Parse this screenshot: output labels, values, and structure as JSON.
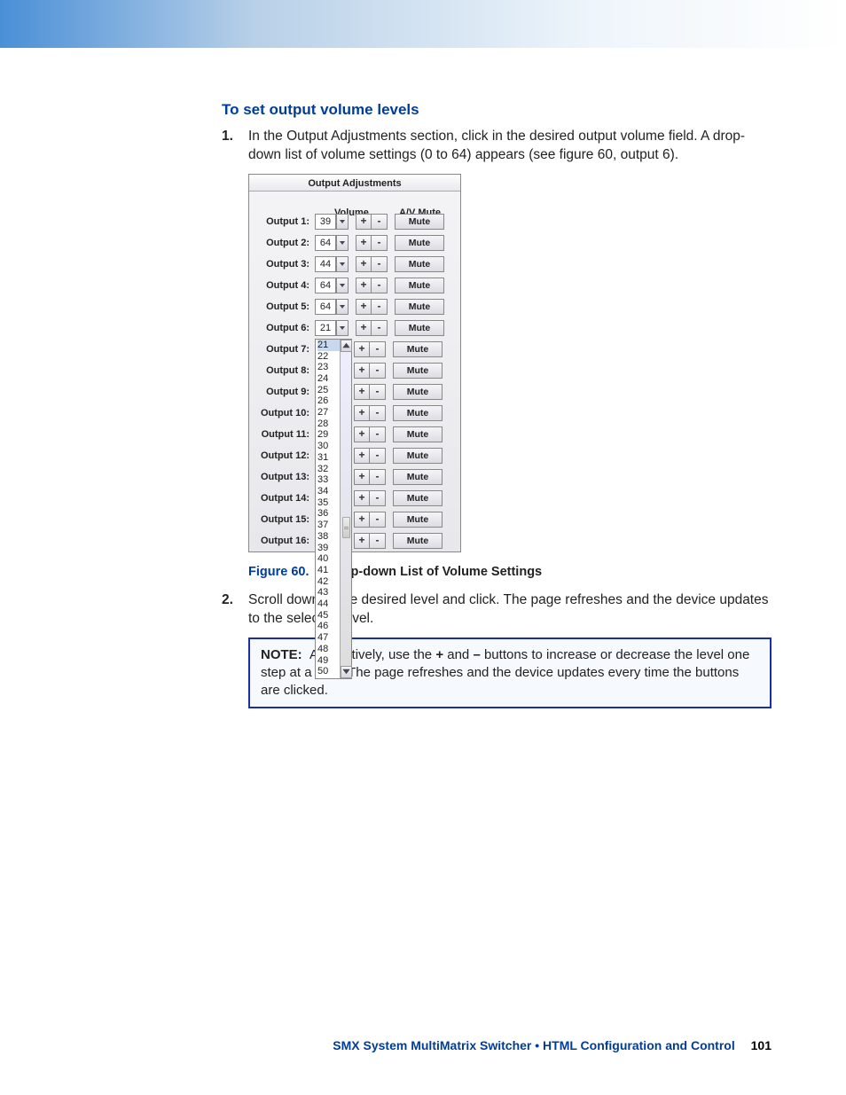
{
  "section_title": "To set output volume levels",
  "step1_num": "1.",
  "step1": "In the Output Adjustments section, click in the desired output volume field. A drop-down list of volume settings (0 to 64) appears (see figure 60, output 6).",
  "panel": {
    "title": "Output Adjustments",
    "volume_header": "Volume",
    "mute_header": "A/V Mute",
    "plus": "+",
    "minus": "-",
    "mute_label": "Mute",
    "rows": [
      {
        "label": "Output 1:",
        "value": "39",
        "show_value": true,
        "show_dd": true
      },
      {
        "label": "Output 2:",
        "value": "64",
        "show_value": true,
        "show_dd": true
      },
      {
        "label": "Output 3:",
        "value": "44",
        "show_value": true,
        "show_dd": true
      },
      {
        "label": "Output 4:",
        "value": "64",
        "show_value": true,
        "show_dd": true
      },
      {
        "label": "Output 5:",
        "value": "64",
        "show_value": true,
        "show_dd": true
      },
      {
        "label": "Output 6:",
        "value": "21",
        "show_value": true,
        "show_dd": true
      },
      {
        "label": "Output 7:",
        "value": "",
        "show_value": false,
        "show_dd": false
      },
      {
        "label": "Output 8:",
        "value": "",
        "show_value": false,
        "show_dd": false
      },
      {
        "label": "Output 9:",
        "value": "",
        "show_value": false,
        "show_dd": false
      },
      {
        "label": "Output 10:",
        "value": "",
        "show_value": false,
        "show_dd": false
      },
      {
        "label": "Output 11:",
        "value": "",
        "show_value": false,
        "show_dd": false
      },
      {
        "label": "Output 12:",
        "value": "",
        "show_value": false,
        "show_dd": false
      },
      {
        "label": "Output 13:",
        "value": "",
        "show_value": false,
        "show_dd": false
      },
      {
        "label": "Output 14:",
        "value": "",
        "show_value": false,
        "show_dd": false
      },
      {
        "label": "Output 15:",
        "value": "",
        "show_value": false,
        "show_dd": false
      },
      {
        "label": "Output 16:",
        "value": "",
        "show_value": false,
        "show_dd": false
      }
    ],
    "dropdown_values": [
      "21",
      "22",
      "23",
      "24",
      "25",
      "26",
      "27",
      "28",
      "29",
      "30",
      "31",
      "32",
      "33",
      "34",
      "35",
      "36",
      "37",
      "38",
      "39",
      "40",
      "41",
      "42",
      "43",
      "44",
      "45",
      "46",
      "47",
      "48",
      "49",
      "50"
    ],
    "dropdown_selected": "21"
  },
  "caption": {
    "figure": "Figure 60.",
    "text": "Drop-down List of Volume Settings"
  },
  "step2_num": "2.",
  "step2": "Scroll down to the desired level and click. The page refreshes and the device updates to the selected level.",
  "note": {
    "label": "NOTE:",
    "text_before_plus": "Alternatively, use the ",
    "text_mid": " and ",
    "text_after_minus": " buttons to increase or decrease the level one step at a time. The page refreshes and the device updates every time the buttons are clicked.",
    "plus": "+",
    "minus": "–"
  },
  "footer": {
    "title": "SMX System MultiMatrix Switcher • HTML Configuration and Control",
    "page": "101"
  }
}
